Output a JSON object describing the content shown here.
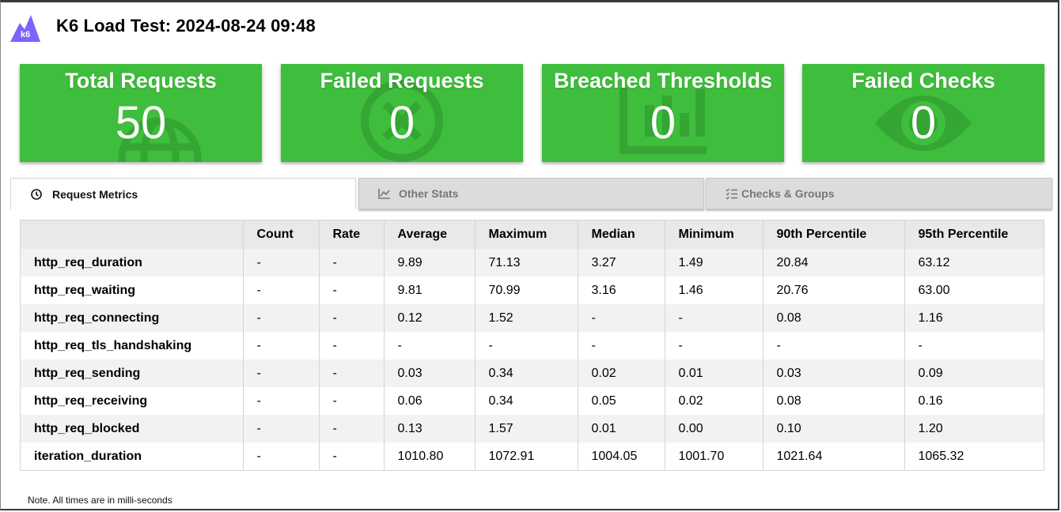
{
  "header": {
    "title": "K6 Load Test: 2024-08-24 09:48",
    "logo_text": "k6"
  },
  "colors": {
    "card_green": "#3fbd3c",
    "logo_purple": "#7d64ff"
  },
  "cards": [
    {
      "label": "Total Requests",
      "value": "50",
      "icon": "globe-icon"
    },
    {
      "label": "Failed Requests",
      "value": "0",
      "icon": "x-circle-icon"
    },
    {
      "label": "Breached Thresholds",
      "value": "0",
      "icon": "bar-chart-icon"
    },
    {
      "label": "Failed Checks",
      "value": "0",
      "icon": "eye-icon"
    }
  ],
  "tabs": [
    {
      "label": "Request Metrics",
      "icon": "clock-icon",
      "active": true
    },
    {
      "label": "Other Stats",
      "icon": "line-chart-icon",
      "active": false
    },
    {
      "label": "Checks & Groups",
      "icon": "checklist-icon",
      "active": false
    }
  ],
  "table": {
    "headers": [
      "",
      "Count",
      "Rate",
      "Average",
      "Maximum",
      "Median",
      "Minimum",
      "90th Percentile",
      "95th Percentile"
    ],
    "rows": [
      [
        "http_req_duration",
        "-",
        "-",
        "9.89",
        "71.13",
        "3.27",
        "1.49",
        "20.84",
        "63.12"
      ],
      [
        "http_req_waiting",
        "-",
        "-",
        "9.81",
        "70.99",
        "3.16",
        "1.46",
        "20.76",
        "63.00"
      ],
      [
        "http_req_connecting",
        "-",
        "-",
        "0.12",
        "1.52",
        "-",
        "-",
        "0.08",
        "1.16"
      ],
      [
        "http_req_tls_handshaking",
        "-",
        "-",
        "-",
        "-",
        "-",
        "-",
        "-",
        "-"
      ],
      [
        "http_req_sending",
        "-",
        "-",
        "0.03",
        "0.34",
        "0.02",
        "0.01",
        "0.03",
        "0.09"
      ],
      [
        "http_req_receiving",
        "-",
        "-",
        "0.06",
        "0.34",
        "0.05",
        "0.02",
        "0.08",
        "0.16"
      ],
      [
        "http_req_blocked",
        "-",
        "-",
        "0.13",
        "1.57",
        "0.01",
        "0.00",
        "0.10",
        "1.20"
      ],
      [
        "iteration_duration",
        "-",
        "-",
        "1010.80",
        "1072.91",
        "1004.05",
        "1001.70",
        "1021.64",
        "1065.32"
      ]
    ]
  },
  "footer": {
    "note": "Note. All times are in milli-seconds"
  }
}
